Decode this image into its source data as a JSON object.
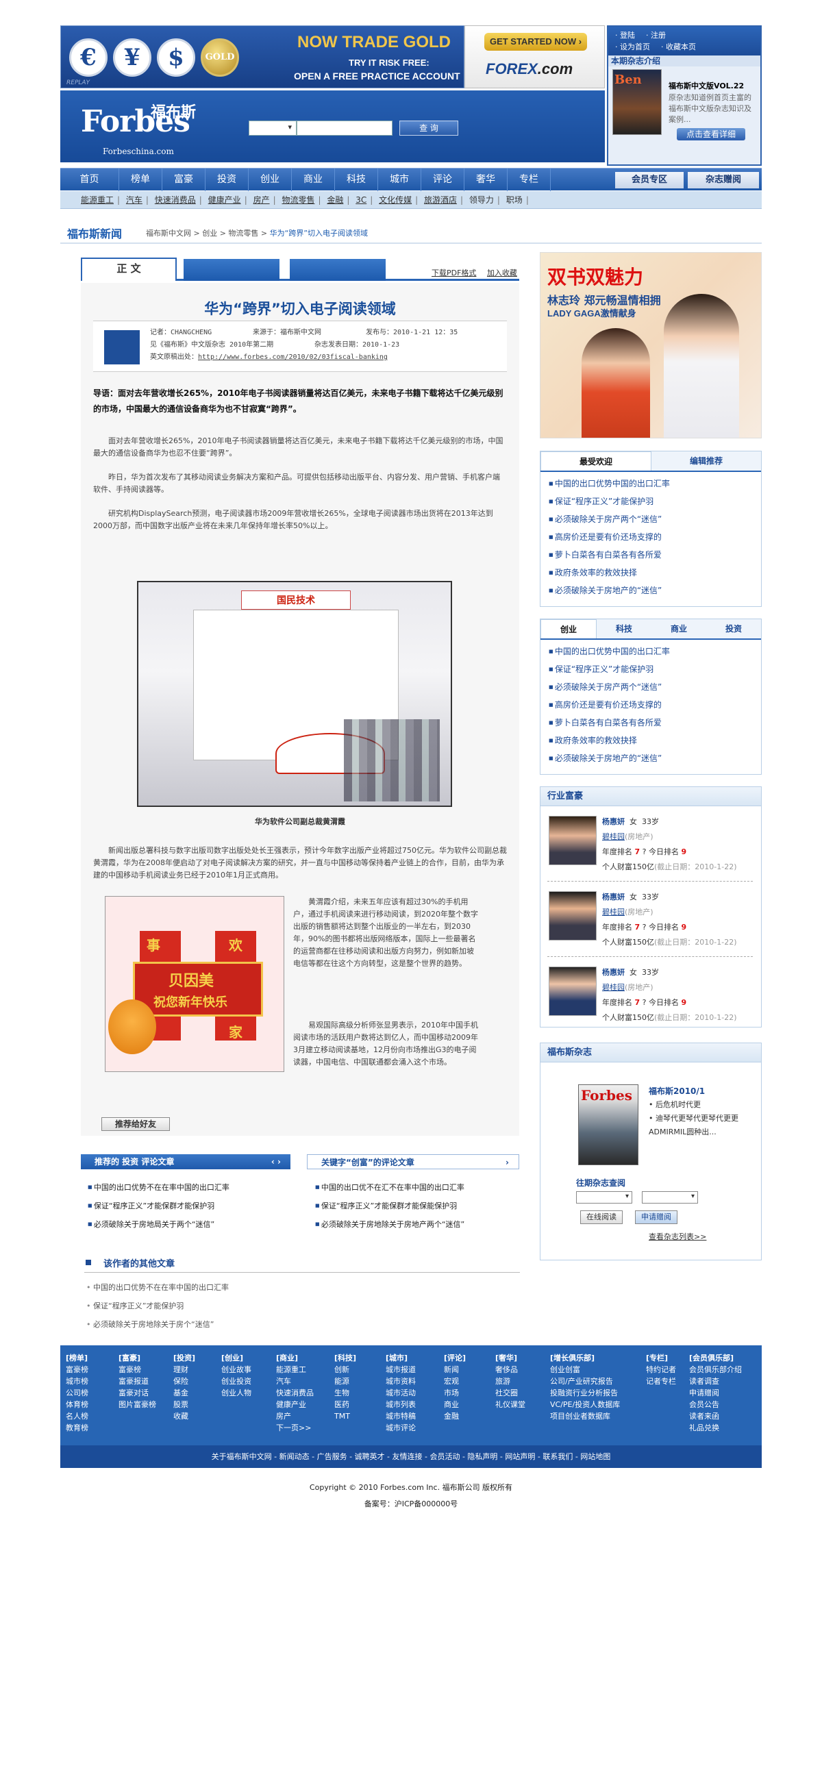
{
  "ad_banner": {
    "currencies": [
      "€",
      "¥",
      "$",
      "GOLD"
    ],
    "replay": "REPLAY",
    "title": "NOW TRADE GOLD",
    "sub1": "TRY IT RISK FREE:",
    "sub2": "OPEN A FREE PRACTICE ACCOUNT",
    "cta": "GET STARTED NOW ›",
    "brand_pre": "FOREX",
    "brand_post": ".com"
  },
  "masthead": {
    "logo": "Forbes",
    "logo_cn": "福布斯",
    "logo_url": "Forbeschina.com",
    "search_button": "查 询"
  },
  "side_box": {
    "links_row1": [
      "· 登陆",
      "· 注册"
    ],
    "links_row2": [
      "· 设为首页",
      "· 收藏本页"
    ],
    "mag_header": "本期杂志介绍",
    "cover_text": "Ben",
    "mag_title": "福布斯中文版VOL.22",
    "mag_desc": "原杂志知道例首页主富的福布斯中文版杂志知识及案例...",
    "read_button": "点击查看详细"
  },
  "nav": {
    "items": [
      "首页",
      "榜单",
      "富豪",
      "投资",
      "创业",
      "商业",
      "科技",
      "城市",
      "评论",
      "奢华",
      "专栏"
    ],
    "member": "会员专区",
    "gift": "杂志赠阅"
  },
  "subnav": [
    "能源重工",
    "汽车",
    "快速消费品",
    "健康产业",
    "房产",
    "物流零售",
    "金融",
    "3C",
    "文化传媒",
    "旅游酒店",
    "领导力",
    "职场"
  ],
  "breadcrumb": {
    "title": "福布斯新闻",
    "path": "福布斯中文网 > 创业 > 物流零售 >",
    "current": "华为“跨界”切入电子阅读领域"
  },
  "article": {
    "tab_main": "正 文",
    "link_pdf": "下载PDF格式",
    "link_fav": "加入收藏",
    "title": "华为“跨界”切入电子阅读领域",
    "meta": {
      "author": "记者：CHANGCHENG",
      "source": "来源于：福布斯中文网",
      "published": "发布与：2010-1-21 12：35",
      "issue": "见《福布斯》中文版杂志 2010年第二期",
      "issue_date": "杂志发表日期：2010-1-23",
      "url_label": "英文原稿出处：",
      "url": "http://www.forbes.com/2010/02/03fiscal-banking"
    },
    "lead": "导语：面对去年营收增长265%，2010年电子书阅读器销量将达百亿美元，未来电子书籍下载将达千亿美元级别的市场，中国最大的通信设备商华为也不甘寂寞“跨界”。",
    "p1": "面对去年营收增长265%，2010年电子书阅读器销量将达百亿美元，未来电子书籍下载将达千亿美元级别的市场，中国最大的通信设备商华为也忍不住要“跨界”。",
    "p2": "昨日，华为首次发布了其移动阅读业务解决方案和产品。可提供包括移动出版平台、内容分发、用户营销、手机客户端软件、手持阅读器等。",
    "p3": "研究机构DisplaySearch预测，电子阅读器市场2009年营收增长265%，全球电子阅读器市场出货将在2013年达到2000万部，而中国数字出版产业将在未来几年保持年增长率50%以上。",
    "photo1_sign": "国民技术",
    "caption1": "华为软件公司副总裁黄渭霞",
    "p4": "新闻出版总署科技与数字出版司数字出版处处长王强表示，预计今年数字出版产业将超过750亿元。华为软件公司副总裁黄渭霞，华为在2008年便启动了对电子阅读解决方案的研究，并一直与中国移动等保持着产业链上的合作，目前，由华为承建的中国移动手机阅读业务已经于2010年1月正式商用。",
    "photo2": {
      "c1": "事",
      "c2": "欢",
      "c3": "贝因美",
      "c4": "祝您新年快乐",
      "c5": "家"
    },
    "p5": "黄渭霞介绍，未来五年应该有超过30%的手机用户，通过手机阅读来进行移动阅读，到2020年整个数字出版的销售额将达到整个出版业的一半左右，到2030年，90%的图书都将出版网络版本，国际上一些最著名的运营商都在往移动阅读和出版方向努力，例如新加坡电信等都在往这个方向转型，这是整个世界的趋势。",
    "p6": "易观国际高级分析师张显男表示，2010年中国手机阅读市场的活跃用户数将达到亿人，而中国移动2009年3月建立移动阅读基地，12月份向市场推出G3的电子阅读器，中国电信、中国联通都会涌入这个市场。",
    "recommend_button": "推荐给好友"
  },
  "related": {
    "title1": "推荐的  投资  评论文章",
    "title2": "关键字“创富”的评论文章",
    "list1": [
      "中国的出口优势不在在率中国的出口汇率",
      "保证“程序正义”才能保群才能保护羽",
      "必须破除关于房地局关于两个“迷信”"
    ],
    "list2": [
      "中国的出口优不在汇不在率中国的出口汇率",
      "保证“程序正义”才能保群才能保能保护羽",
      "必须破除关于房地除关于房地产两个“迷信”"
    ],
    "other_title": "该作者的其他文章",
    "other_list": [
      "中国的出口优势不在在率中国的出口汇率",
      "保证“程序正义”才能保护羽",
      "必须破除关于房地除关于房个“迷信”"
    ]
  },
  "right_ad": {
    "t1": "双书双魅力",
    "t2": "林志玲 郑元畅温情相拥",
    "t3": "LADY GAGA激情献身"
  },
  "popular": {
    "tabs": [
      "最受欢迎",
      "编辑推荐"
    ],
    "items": [
      "中国的出口优势中国的出口汇率",
      "保证“程序正义”才能保护羽",
      "必须破除关于房产两个“迷信”",
      "高房价还是要有价还场支撑的",
      "萝卜白菜各有白菜各有各所爱",
      "政府条效率的救效抉择",
      "必须破除关于房地产的“迷信”"
    ]
  },
  "category": {
    "tabs": [
      "创业",
      "科技",
      "商业",
      "投资"
    ],
    "items": [
      "中国的出口优势中国的出口汇率",
      "保证“程序正义”才能保护羽",
      "必须破除关于房产两个“迷信”",
      "高房价还是要有价还场支撑的",
      "萝卜白菜各有白菜各有各所爱",
      "政府条效率的救效抉择",
      "必须破除关于房地产的“迷信”"
    ]
  },
  "rich": {
    "title": "行业富豪",
    "people": [
      {
        "name": "杨惠妍",
        "gender": "女",
        "age": "33岁",
        "company": "碧桂园",
        "industry": "(房地产)",
        "rank_label": "年度排名",
        "rank": "7",
        "today_label": "今日排名",
        "today": "9",
        "wealth": "个人财富150亿",
        "date": "(截止日期：2010-1-22)"
      },
      {
        "name": "杨惠妍",
        "gender": "女",
        "age": "33岁",
        "company": "碧桂园",
        "industry": "(房地产)",
        "rank_label": "年度排名",
        "rank": "7",
        "today_label": "今日排名",
        "today": "9",
        "wealth": "个人财富150亿",
        "date": "(截止日期：2010-1-22)"
      },
      {
        "name": "杨惠妍",
        "gender": "女",
        "age": "33岁",
        "company": "碧桂园",
        "industry": "(房地产)",
        "rank_label": "年度排名",
        "rank": "7",
        "today_label": "今日排名",
        "today": "9",
        "wealth": "个人财富150亿",
        "date": "(截止日期：2010-1-22)"
      }
    ]
  },
  "magazine": {
    "title": "福布斯杂志",
    "cover": "Forbes",
    "issue": "福布斯2010/1",
    "bullets": [
      "后危机时代更",
      "迪琴代更琴代更琴代更更ADMIRMIL圆种出..."
    ],
    "query_label": "往期杂志查阅",
    "btn_online": "在线阅读",
    "btn_apply": "申请赠阅",
    "more": "查看杂志列表>>"
  },
  "footer": {
    "columns": [
      {
        "h": "[榜单]",
        "items": [
          "富豪榜",
          "城市榜",
          "公司榜",
          "体育榜",
          "名人榜",
          "教育榜"
        ]
      },
      {
        "h": "[富豪]",
        "items": [
          "富豪榜",
          "富豪报道",
          "富豪对话",
          "图片富豪榜"
        ]
      },
      {
        "h": "[投资]",
        "items": [
          "理财",
          "保险",
          "基金",
          "股票",
          "收藏"
        ]
      },
      {
        "h": "[创业]",
        "items": [
          "创业故事",
          "创业投资",
          "创业人物"
        ]
      },
      {
        "h": "[商业]",
        "items": [
          "能源重工",
          "汽车",
          "快速消费品",
          "健康产业",
          "房产",
          "下一页>>"
        ]
      },
      {
        "h": "[科技]",
        "items": [
          "创新",
          "能源",
          "生物",
          "医药",
          "TMT"
        ]
      },
      {
        "h": "[城市]",
        "items": [
          "城市报道",
          "城市资料",
          "城市活动",
          "城市列表",
          "城市特稿",
          "城市评论"
        ]
      },
      {
        "h": "[评论]",
        "items": [
          "新闻",
          "宏观",
          "市场",
          "商业",
          "金融"
        ]
      },
      {
        "h": "[奢华]",
        "items": [
          "奢侈品",
          "旅游",
          "社交圈",
          "礼仪课堂"
        ]
      },
      {
        "h": "[增长俱乐部]",
        "items": [
          "创业创富",
          "公司/产业研究报告",
          "投融资行业分析报告",
          "VC/PE/投资人数据库",
          "项目创业者数据库"
        ]
      },
      {
        "h": "[专栏]",
        "items": [
          "特约记者",
          "记者专栏"
        ]
      },
      {
        "h": "[会员俱乐部]",
        "items": [
          "会员俱乐部介绍",
          "读者调查",
          "申请赠阅",
          "会员公告",
          "读者来函",
          "礼品兑换"
        ]
      }
    ],
    "bar": "关于福布斯中文网 - 新闻动态 - 广告服务 - 诚聘英才 - 友情连接 - 会员活动 - 隐私声明 - 网站声明 - 联系我们 - 网站地图",
    "copyright": "Copyright © 2010 Forbes.com Inc. 福布斯公司 版权所有",
    "icp": "备案号：沪ICP备000000号"
  }
}
